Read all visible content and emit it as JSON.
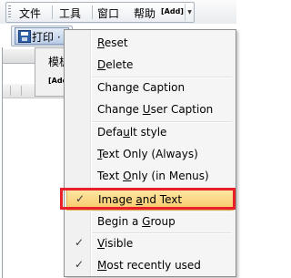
{
  "menubar": {
    "items": [
      {
        "label": "文件"
      },
      {
        "label": "工具"
      },
      {
        "label": "窗口"
      },
      {
        "label": "帮助"
      }
    ],
    "add_label": "[Add]"
  },
  "toolbar": {
    "print_label": "打印",
    "print_suffix": "·"
  },
  "side_menu": {
    "item_label": "模板",
    "add_label": "[Add]"
  },
  "context_menu": {
    "items": [
      {
        "pre": "",
        "ul": "R",
        "post": "eset",
        "checked": false,
        "highlighted": false
      },
      {
        "pre": "",
        "ul": "D",
        "post": "elete",
        "checked": false,
        "highlighted": false
      },
      {
        "pre": "Chan",
        "ul": "g",
        "post": "e Caption",
        "checked": false,
        "highlighted": false
      },
      {
        "pre": "Change ",
        "ul": "U",
        "post": "ser Caption",
        "checked": false,
        "highlighted": false
      },
      {
        "pre": "Defa",
        "ul": "u",
        "post": "lt style",
        "checked": false,
        "highlighted": false
      },
      {
        "pre": "",
        "ul": "T",
        "post": "ext Only (Always)",
        "checked": false,
        "highlighted": false
      },
      {
        "pre": "Text ",
        "ul": "O",
        "post": "nly (in Menus)",
        "checked": false,
        "highlighted": false
      },
      {
        "pre": "Image ",
        "ul": "a",
        "post": "nd Text",
        "checked": true,
        "highlighted": true
      },
      {
        "pre": "Begin a ",
        "ul": "G",
        "post": "roup",
        "checked": false,
        "highlighted": false
      },
      {
        "pre": "",
        "ul": "V",
        "post": "isible",
        "checked": true,
        "highlighted": false
      },
      {
        "pre": "",
        "ul": "M",
        "post": "ost recently used",
        "checked": true,
        "highlighted": false
      }
    ],
    "check_glyph": "✓",
    "highlight_color": "#f8c96a",
    "selection_box_color": "#e8202a"
  }
}
